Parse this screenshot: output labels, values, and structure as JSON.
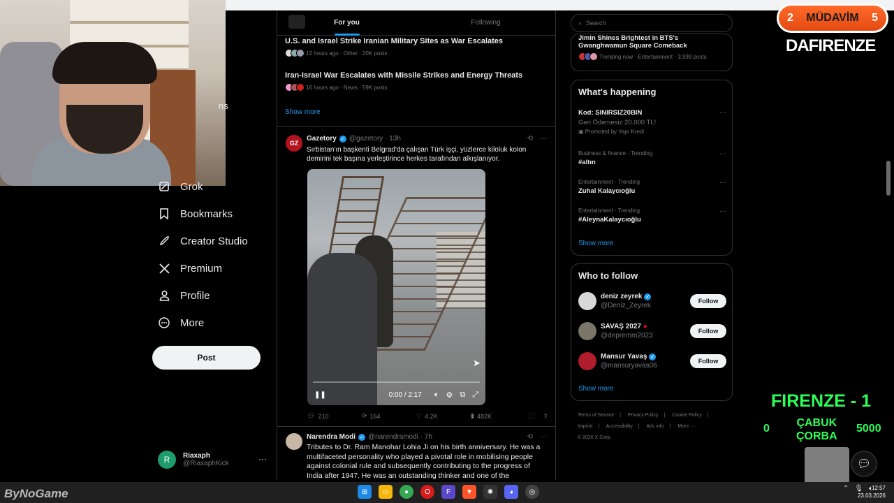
{
  "nav": {
    "partial_label": "ns",
    "items": [
      {
        "label": "Grok",
        "icon": "grok-icon"
      },
      {
        "label": "Bookmarks",
        "icon": "bookmark-icon"
      },
      {
        "label": "Creator Studio",
        "icon": "rocket-icon"
      },
      {
        "label": "Premium",
        "icon": "x-logo-icon"
      },
      {
        "label": "Profile",
        "icon": "person-icon"
      },
      {
        "label": "More",
        "icon": "more-circle-icon"
      }
    ],
    "post_label": "Post",
    "account": {
      "initial": "R",
      "name": "Riaxaph",
      "handle": "@RiaxaphKick",
      "more": "···"
    }
  },
  "feed": {
    "tabs": [
      {
        "label": "For you"
      },
      {
        "label": "Following"
      }
    ],
    "trends": [
      {
        "title": "U.S. and Israel Strike Iranian Military Sites as War Escalates",
        "meta": "12 hours ago · Other · 20K posts"
      },
      {
        "title": "Iran-Israel War Escalates with Missile Strikes and Energy Threats",
        "meta": "16 hours ago · News · 59K posts"
      }
    ],
    "show_more": "Show more",
    "tweet1": {
      "logo": "GZ",
      "name": "Gazetory",
      "handle": "@gazetory · 13h",
      "text": "Sırbistan'ın başkenti Belgrad'da çalışan Türk işçi, yüzlerce kiloluk kolon demirini tek başına yerleştirince herkes tarafından alkışlanıyor.",
      "video_time": "0:00 / 2:17",
      "replies": "210",
      "reposts": "164",
      "likes": "4.2K",
      "views": "482K"
    },
    "tweet2": {
      "name": "Narendra Modi",
      "handle": "@narendramodi · 7h",
      "text": "Tributes to Dr. Ram Manohar Lohia Ji on his birth anniversary. He was a multifaceted personality who played a pivotal role in mobilising people against colonial rule and subsequently contributing to the progress of India after 1947. He was an outstanding thinker and one of the"
    }
  },
  "sidebar": {
    "search_placeholder": "Search",
    "top_trend": {
      "title": "Jimin Shines Brightest in BTS's Gwanghwamun Square Comeback",
      "meta": "Trending now · Entertainment · 3,999 posts"
    },
    "happening": {
      "title": "What's happening",
      "items": [
        {
          "category": "",
          "title": "Kod: SINIRSIZ20BIN",
          "sub": "Geri Ödemesiz 20.000 TL!",
          "promo": "Promoted by Yapı Kredi"
        },
        {
          "category": "Business & finance · Trending",
          "title": "#altın"
        },
        {
          "category": "Entertainment · Trending",
          "title": "Zuhal Kalaycıoğlu"
        },
        {
          "category": "Entertainment · Trending",
          "title": "#AleynaKalaycıoğlu"
        }
      ],
      "show_more": "Show more"
    },
    "who_to_follow": {
      "title": "Who to follow",
      "users": [
        {
          "name": "deniz zeyrek",
          "handle": "@Deniz_Zeyrek",
          "verified": true
        },
        {
          "name": "SAVAŞ 2027",
          "handle": "@depremm2023",
          "verified": false
        },
        {
          "name": "Mansur Yavaş",
          "handle": "@mansuryavas06",
          "verified": true
        }
      ],
      "follow_label": "Follow",
      "show_more": "Show more"
    },
    "footer": {
      "links": [
        "Terms of Service",
        "|",
        "Privacy Policy",
        "|",
        "Cookie Policy",
        "|",
        "Imprint",
        "|",
        "Accessibility",
        "|",
        "Ads info",
        "|",
        "More ···"
      ],
      "copyright": "© 2026 X Corp."
    }
  },
  "overlay": {
    "badge_left": "2",
    "badge_label": "MÜDAVİM",
    "badge_right": "5",
    "dafirenze": "DAFIRENZE",
    "firenze": "FIRENZE - 1",
    "zero": "0",
    "cabuk": "ÇABUK",
    "corba": "ÇORBA",
    "score": "5000",
    "bynogame": "ByNoGame"
  },
  "taskbar": {
    "time": "12:57",
    "date": "23.03.2026"
  },
  "colors": {
    "accent": "#1d9bf0",
    "overlay_green": "#2cff58",
    "badge_orange": "#e34a12"
  }
}
